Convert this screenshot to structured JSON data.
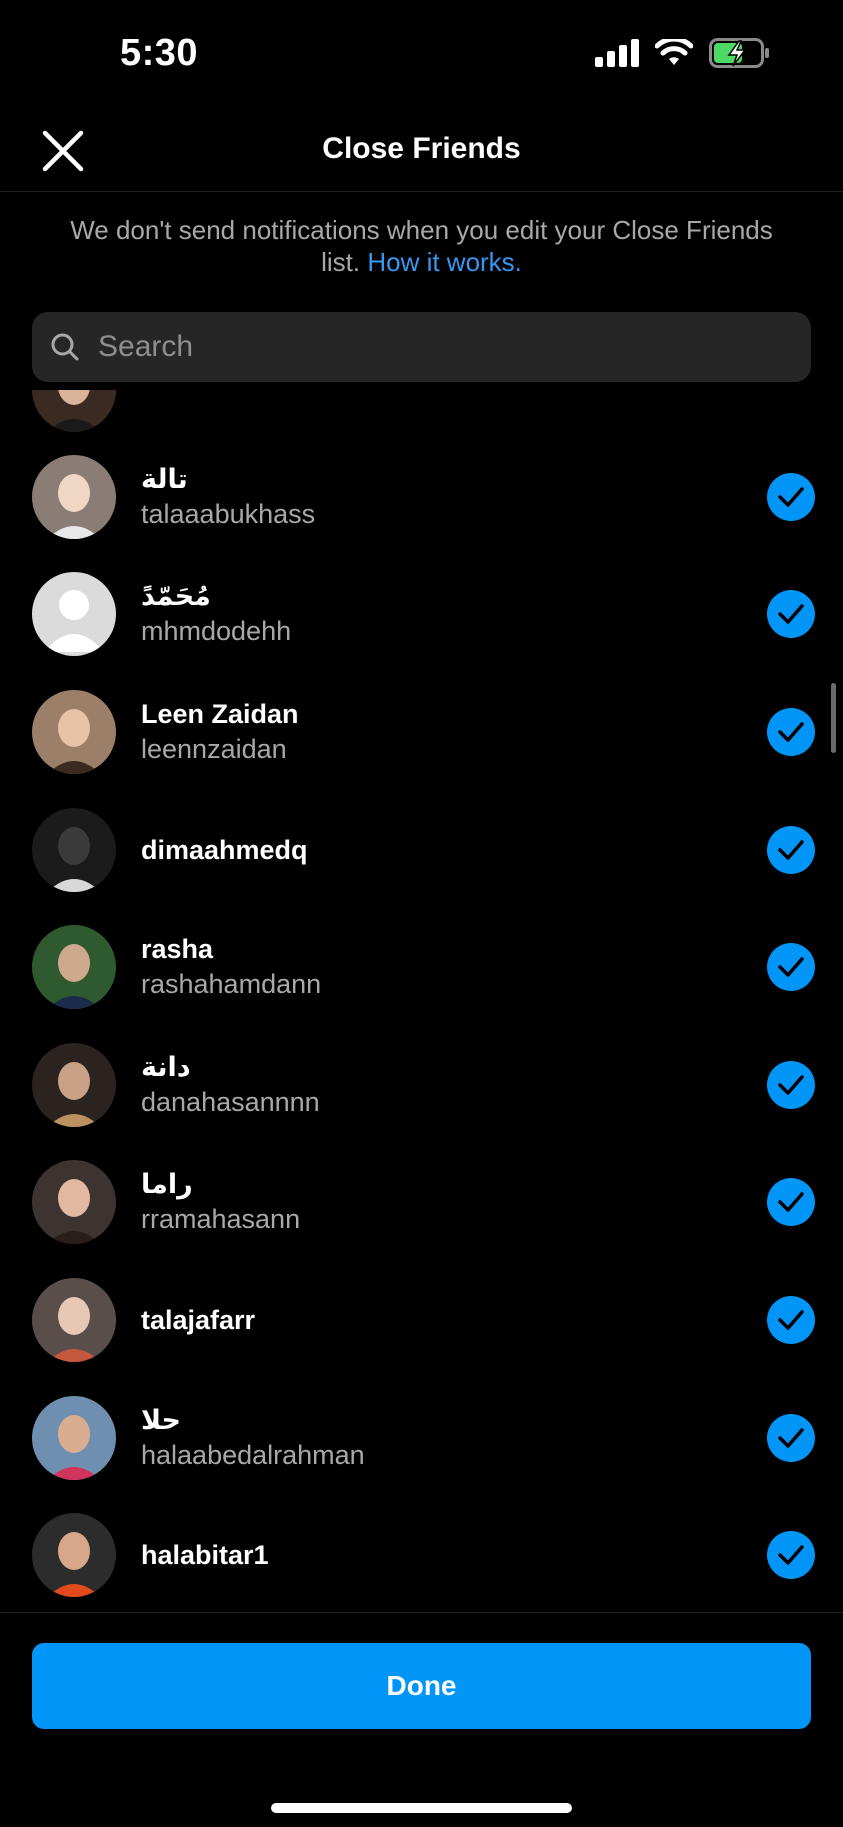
{
  "status_bar": {
    "time": "5:30"
  },
  "header": {
    "title": "Close Friends"
  },
  "notice": {
    "text": "We don't send notifications when you edit your Close Friends list. ",
    "link": "How it works."
  },
  "search": {
    "placeholder": "Search"
  },
  "friends": [
    {
      "display_name": "",
      "username": ""
    },
    {
      "display_name": "تالة",
      "username": "talaaabukhass"
    },
    {
      "display_name": "مُحَمّدً",
      "username": "mhmdodehh"
    },
    {
      "display_name": "Leen Zaidan",
      "username": "leennzaidan"
    },
    {
      "display_name": "dimaahmedq",
      "username": ""
    },
    {
      "display_name": "rasha",
      "username": "rashahamdann"
    },
    {
      "display_name": "دانة",
      "username": "danahasannnn"
    },
    {
      "display_name": "راما",
      "username": "rramahasann"
    },
    {
      "display_name": "talajafarr",
      "username": ""
    },
    {
      "display_name": "حلا",
      "username": "halaabedalrahman"
    },
    {
      "display_name": "halabitar1",
      "username": ""
    }
  ],
  "footer": {
    "done_label": "Done"
  },
  "colors": {
    "accent": "#0095f6",
    "link": "#3897f0",
    "background": "#000000",
    "secondary_text": "#a8a8a8",
    "search_bg": "#262626"
  }
}
